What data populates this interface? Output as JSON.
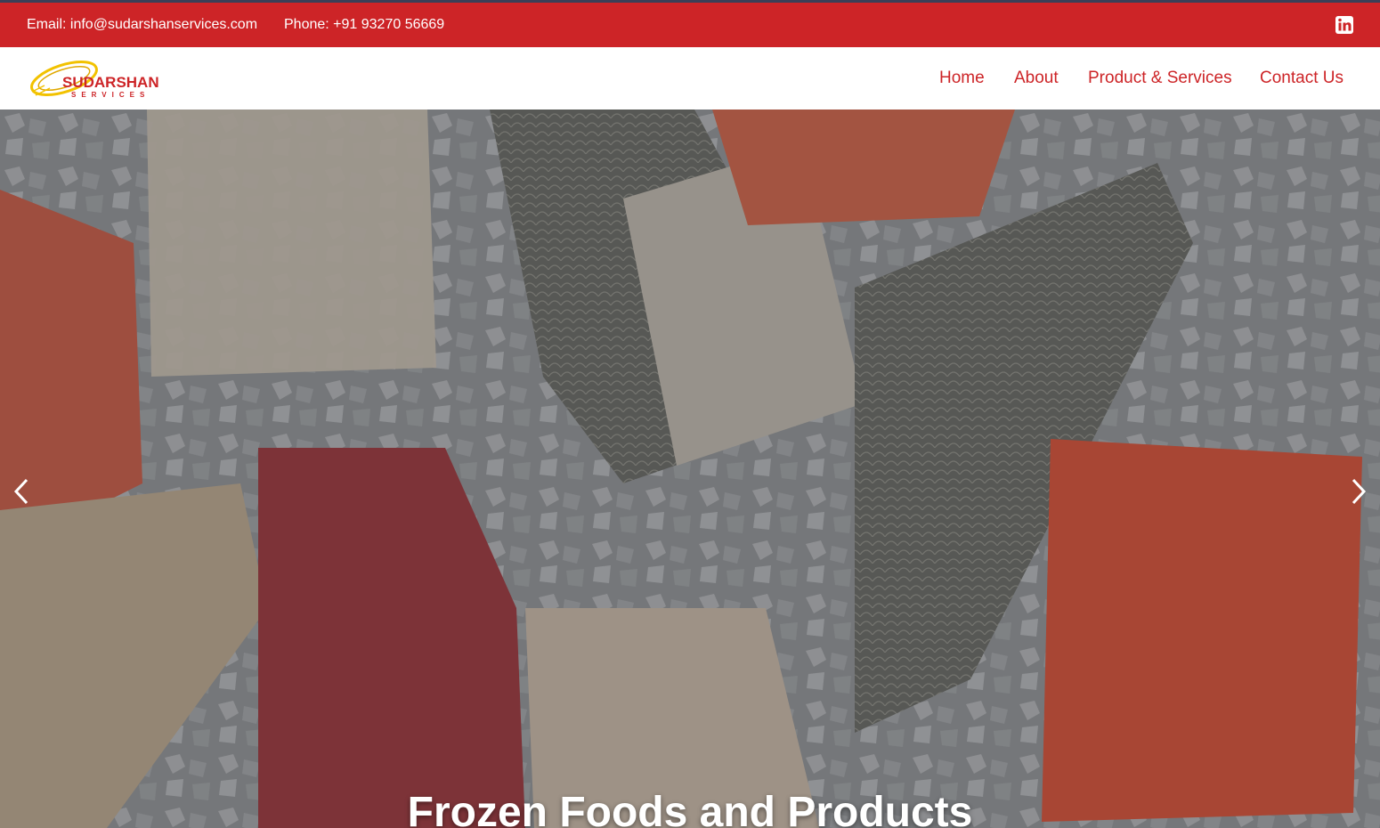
{
  "topbar": {
    "email_label": "Email:",
    "email": "info@sudarshanservices.com",
    "phone_label": "Phone:",
    "phone": "+91 93270 56669",
    "social_icon": "linkedin-icon"
  },
  "brand": {
    "name": "SUDARSHAN",
    "tagline": "SERVICES",
    "logo_color": "#cd2427",
    "logo_ring_color": "#f2c200"
  },
  "nav": {
    "items": [
      {
        "label": "Home"
      },
      {
        "label": "About"
      },
      {
        "label": "Product & Services"
      },
      {
        "label": "Contact Us"
      }
    ]
  },
  "hero": {
    "title": "Frozen Foods and Products",
    "prev_icon": "chevron-left-icon",
    "next_icon": "chevron-right-icon"
  },
  "colors": {
    "brand_red": "#cd2427",
    "accent_dark": "#3a3f57"
  }
}
